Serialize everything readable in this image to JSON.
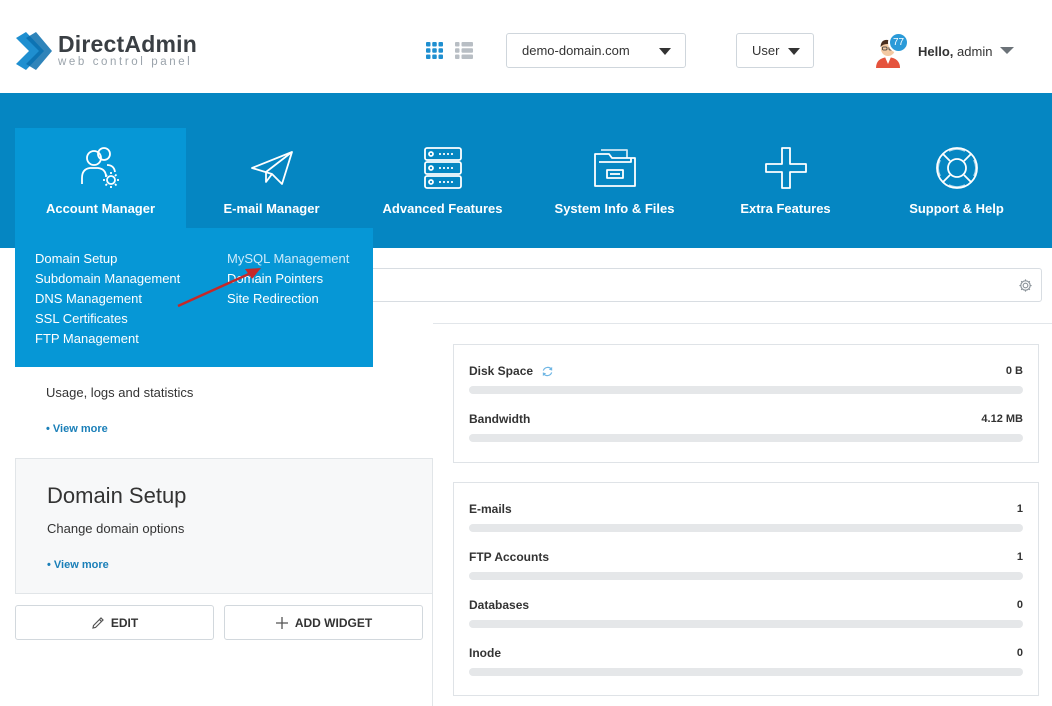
{
  "header": {
    "logo_title": "DirectAdmin",
    "logo_subtitle": "web control panel",
    "domain_select": "demo-domain.com",
    "level_select": "User",
    "notifications": "77",
    "greeting": "Hello,",
    "username": "admin"
  },
  "colors": {
    "nav_bg": "#0586c2",
    "nav_active": "#0697d6",
    "accent": "#2a9ad8",
    "link": "#1a7fb8"
  },
  "nav": {
    "items": [
      {
        "label": "Account Manager",
        "icon": "users-gear-icon"
      },
      {
        "label": "E-mail Manager",
        "icon": "paper-plane-icon"
      },
      {
        "label": "Advanced Features",
        "icon": "database-server-icon"
      },
      {
        "label": "System Info & Files",
        "icon": "folder-icon"
      },
      {
        "label": "Extra Features",
        "icon": "plus-icon"
      },
      {
        "label": "Support & Help",
        "icon": "lifebuoy-icon"
      }
    ]
  },
  "menu": {
    "col1": [
      "Domain Setup",
      "Subdomain Management",
      "DNS Management",
      "SSL Certificates",
      "FTP Management"
    ],
    "col2": [
      "MySQL Management",
      "Domain Pointers",
      "Site Redirection"
    ]
  },
  "widgets": [
    {
      "title": "",
      "desc": "Usage, logs and statistics",
      "more": "• View more"
    },
    {
      "title": "Domain Setup",
      "desc": "Change domain options",
      "more": "• View more"
    }
  ],
  "buttons": {
    "edit": "EDIT",
    "add_widget": "ADD WIDGET"
  },
  "stats_usage": [
    {
      "label": "Disk Space",
      "value": "0 B",
      "fill": 0
    },
    {
      "label": "Bandwidth",
      "value": "4.12 MB",
      "fill": 0
    }
  ],
  "stats_counts": [
    {
      "label": "E-mails",
      "value": "1",
      "fill": 0
    },
    {
      "label": "FTP Accounts",
      "value": "1",
      "fill": 0
    },
    {
      "label": "Databases",
      "value": "0",
      "fill": 0
    },
    {
      "label": "Inode",
      "value": "0",
      "fill": 0
    }
  ]
}
